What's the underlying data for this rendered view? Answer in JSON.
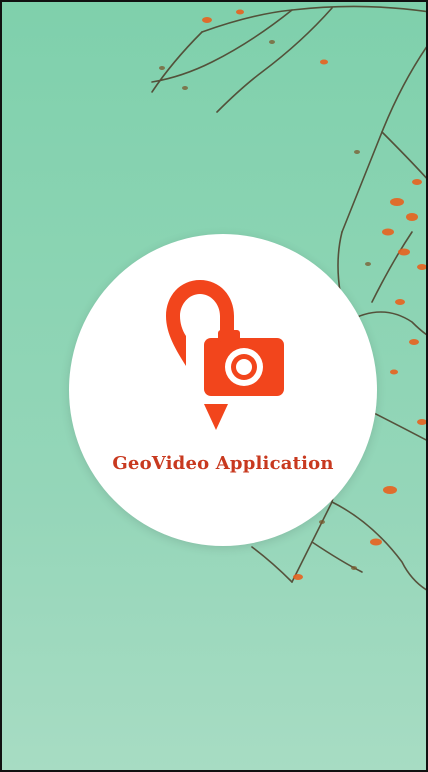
{
  "splash": {
    "app_name": "GeoVideo Application",
    "logo_icon": "location-pin-camera-icon",
    "background": "tree-branches-autumn-leaves"
  },
  "colors": {
    "brand": "#f2451c",
    "text": "#c8391f",
    "background": "#8bd4b3",
    "circle": "#ffffff"
  }
}
